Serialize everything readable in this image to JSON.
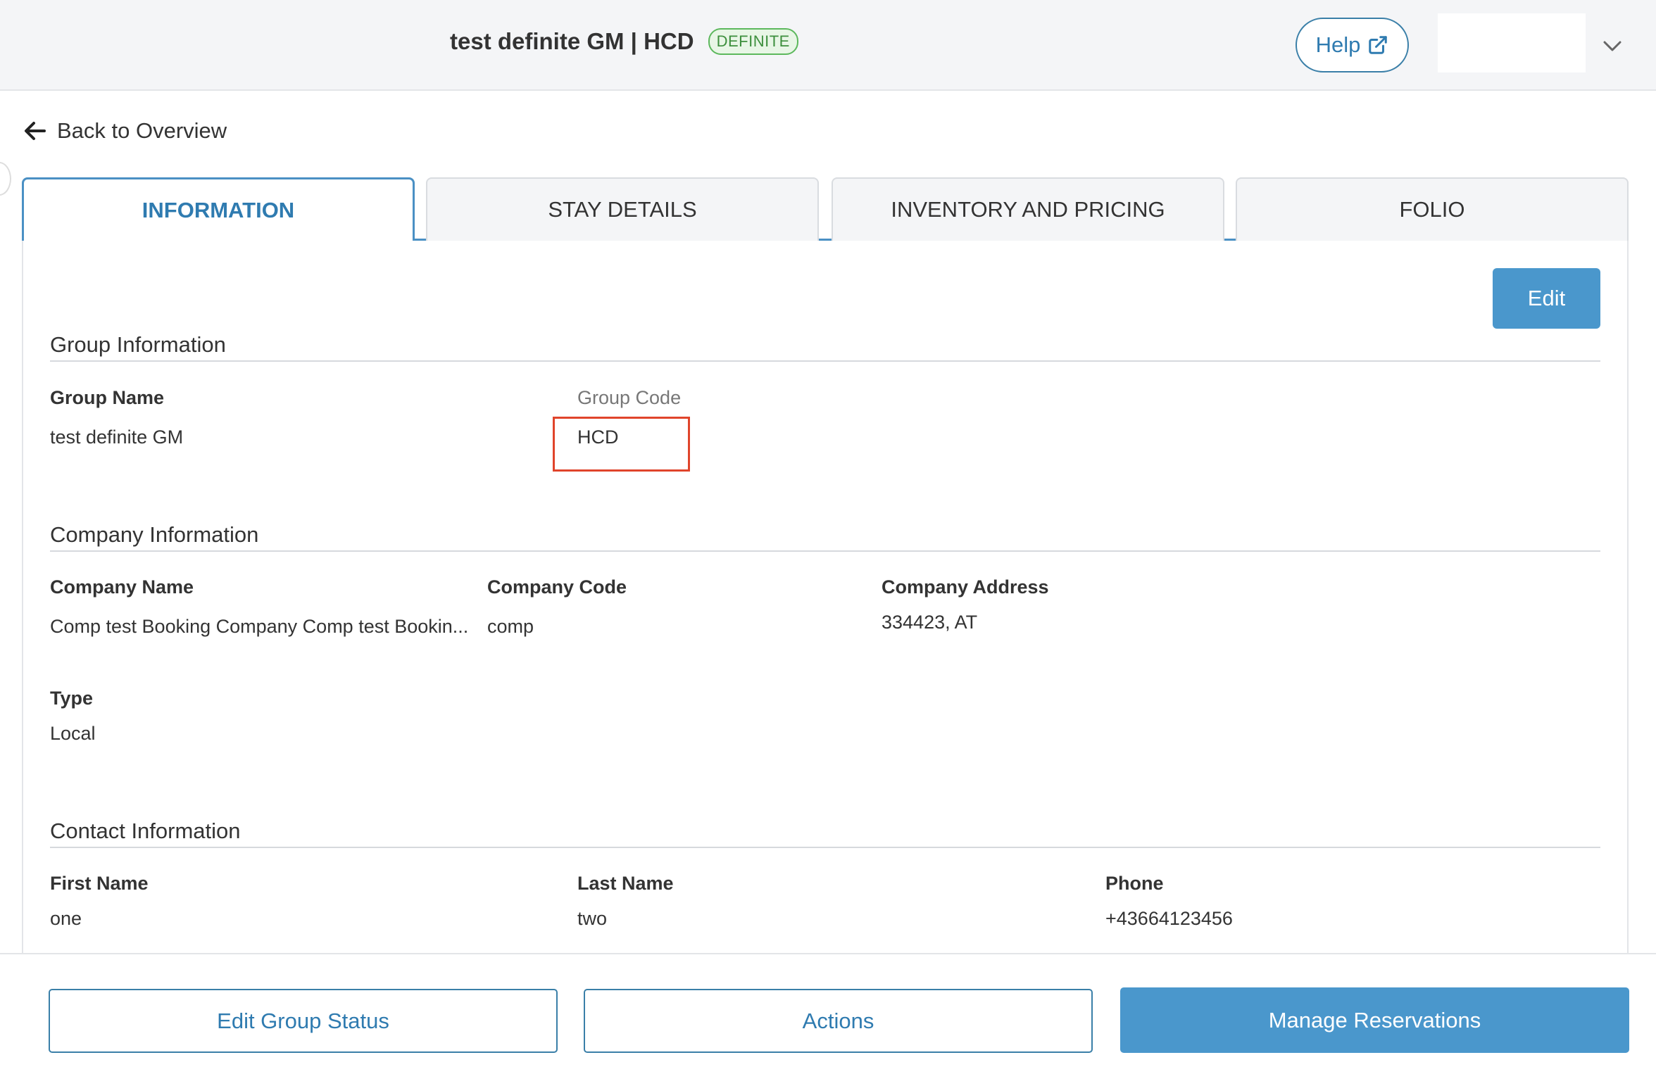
{
  "header": {
    "title": "test definite GM | HCD",
    "status_badge": "DEFINITE",
    "help_label": "Help"
  },
  "back_link": {
    "label": "Back to Overview"
  },
  "tabs": [
    {
      "label": "INFORMATION",
      "active": true
    },
    {
      "label": "STAY DETAILS",
      "active": false
    },
    {
      "label": "INVENTORY AND PRICING",
      "active": false
    },
    {
      "label": "FOLIO",
      "active": false
    }
  ],
  "edit_button": {
    "label": "Edit"
  },
  "group_information": {
    "title": "Group Information",
    "group_name_label": "Group Name",
    "group_name": "test definite GM",
    "group_code_label": "Group Code",
    "group_code": "HCD"
  },
  "company_information": {
    "title": "Company Information",
    "company_name_label": "Company Name",
    "company_name": "Comp test Booking Company Comp test Bookin...",
    "company_code_label": "Company Code",
    "company_code": "comp",
    "company_address_label": "Company Address",
    "company_address": "334423, AT",
    "type_label": "Type",
    "type": "Local"
  },
  "contact_information": {
    "title": "Contact Information",
    "first_name_label": "First Name",
    "first_name": "one",
    "last_name_label": "Last Name",
    "last_name": "two",
    "phone_label": "Phone",
    "phone": "+43664123456"
  },
  "footer": {
    "edit_group_status_label": "Edit Group Status",
    "actions_label": "Actions",
    "manage_reservations_label": "Manage Reservations"
  },
  "colors": {
    "accent": "#4a97cc",
    "badge_green": "#5cb85c",
    "highlight_red": "#e0442b"
  }
}
